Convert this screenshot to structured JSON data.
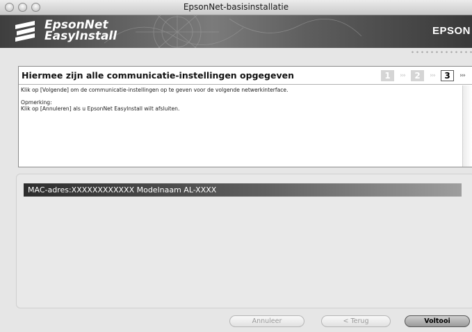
{
  "window": {
    "title": "EpsonNet-basisinstallatie"
  },
  "banner": {
    "logo_line1": "EpsonNet",
    "logo_line2": "EasyInstall",
    "brand": "EPSON"
  },
  "header": {
    "heading": "Hiermee zijn alle communicatie-instellingen opgegeven",
    "steps": [
      "1",
      "2",
      "3"
    ],
    "active_step": "3",
    "step_arrows": "›››"
  },
  "message": {
    "line1": "Klik op [Volgende] om de communicatie-instellingen op te geven voor de volgende netwerkinterface.",
    "note_label": "Opmerking:",
    "line2": "Klik op [Annuleren] als u EpsonNet EasyInstall wilt afsluiten."
  },
  "device_list": {
    "rows": [
      {
        "text": "MAC-adres:XXXXXXXXXXXX  Modelnaam AL-XXXX"
      }
    ]
  },
  "buttons": {
    "cancel": "Annuleer",
    "back": "< Terug",
    "finish": "Voltooi"
  },
  "icons": {
    "window_controls": [
      "close-icon",
      "minimize-icon",
      "zoom-icon"
    ],
    "logo": "epsonnet-logo-icon"
  },
  "colors": {
    "banner_dark": "#3e3e3e",
    "selection": "#2d2d2d",
    "window_bg": "#e6e6e6"
  }
}
